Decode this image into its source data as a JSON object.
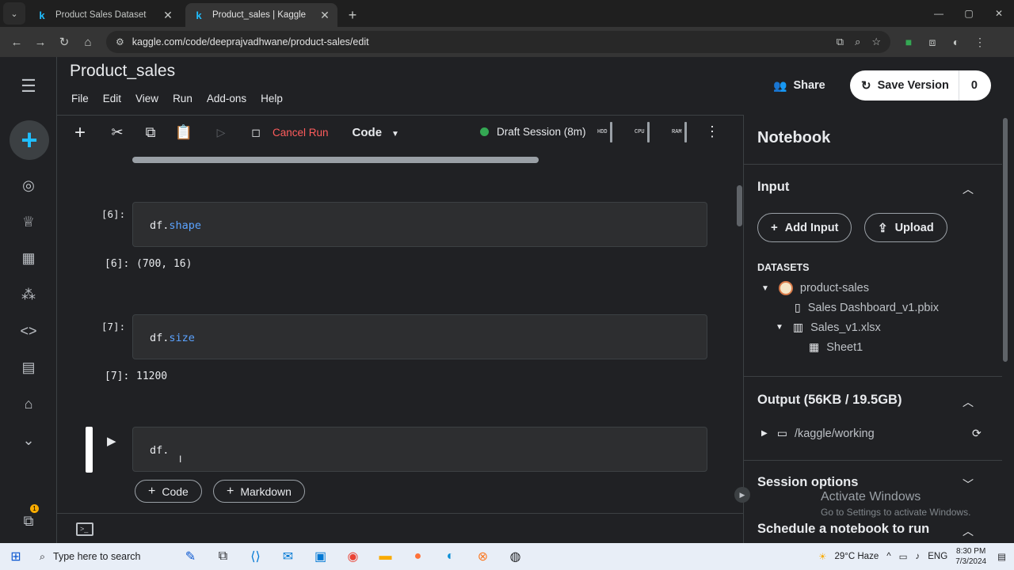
{
  "browser": {
    "tabs": [
      {
        "label": "Product Sales Dataset",
        "favicon": "k",
        "active": false
      },
      {
        "label": "Product_sales | Kaggle",
        "favicon": "k",
        "active": true
      }
    ],
    "url": "kaggle.com/code/deeprajvadhwane/product-sales/edit"
  },
  "notebook": {
    "title": "Product_sales",
    "menu": [
      "File",
      "Edit",
      "View",
      "Run",
      "Add-ons",
      "Help"
    ],
    "share_label": "Share",
    "save_label": "Save Version",
    "save_count": "0",
    "notif_count": "1"
  },
  "toolbar": {
    "cancel_run": "Cancel Run",
    "cell_type": "Code",
    "session": "Draft Session (8m)",
    "meters": [
      "HDD",
      "CPU",
      "RAM"
    ]
  },
  "cells": [
    {
      "prompt": "[6]:",
      "code_obj": "df.",
      "code_attr": "shape",
      "out_prompt": "[6]:",
      "output": "(700, 16)"
    },
    {
      "prompt": "[7]:",
      "code_obj": "df.",
      "code_attr": "size",
      "out_prompt": "[7]:",
      "output": "11200"
    },
    {
      "code_obj": "df.",
      "code_attr": ""
    }
  ],
  "add_cell": {
    "code": "Code",
    "markdown": "Markdown"
  },
  "panel": {
    "title": "Notebook",
    "input_section": "Input",
    "add_input": "Add Input",
    "upload": "Upload",
    "datasets_label": "DATASETS",
    "dataset": "product-sales",
    "files": [
      "Sales Dashboard_v1.pbix",
      "Sales_v1.xlsx"
    ],
    "sheet": "Sheet1",
    "output_section": "Output (56KB / 19.5GB)",
    "output_path": "/kaggle/working",
    "session_options": "Session options",
    "schedule": "Schedule a notebook to run"
  },
  "watermark": {
    "line1": "Activate Windows",
    "line2": "Go to Settings to activate Windows."
  },
  "taskbar": {
    "search_placeholder": "Type here to search",
    "weather": "29°C  Haze",
    "lang": "ENG",
    "time": "8:30 PM",
    "date": "7/3/2024"
  },
  "colors": {
    "kaggle_blue": "#20beff",
    "cancel_red": "#ff5c5c",
    "session_green": "#34a853"
  }
}
